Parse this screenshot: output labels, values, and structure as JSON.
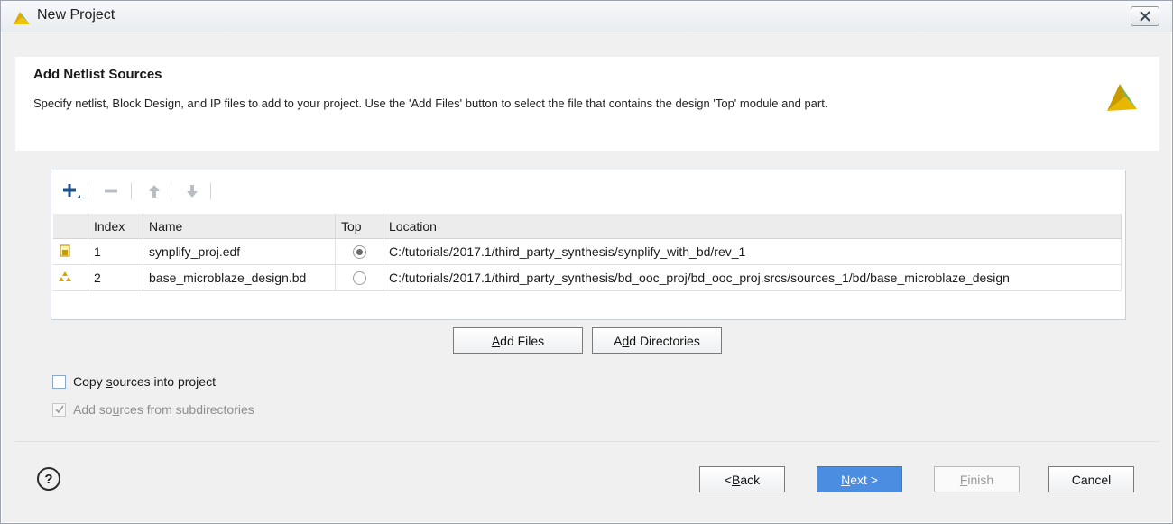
{
  "window": {
    "title": "New Project"
  },
  "header": {
    "heading": "Add Netlist Sources",
    "description": "Specify netlist, Block Design, and IP files to add to your project. Use the 'Add Files' button to select the file that contains the design 'Top' module and part."
  },
  "table": {
    "columns": [
      "Index",
      "Name",
      "Top",
      "Location"
    ],
    "rows": [
      {
        "icon": "netlist-file-icon",
        "index": "1",
        "name": "synplify_proj.edf",
        "top": true,
        "location": "C:/tutorials/2017.1/third_party_synthesis/synplify_with_bd/rev_1"
      },
      {
        "icon": "block-design-icon",
        "index": "2",
        "name": "base_microblaze_design.bd",
        "top": false,
        "location": "C:/tutorials/2017.1/third_party_synthesis/bd_ooc_proj/bd_ooc_proj.srcs/sources_1/bd/base_microblaze_design"
      }
    ]
  },
  "buttons": {
    "add_files": {
      "pre": "",
      "key": "A",
      "post": "dd Files"
    },
    "add_directories": {
      "pre": "A",
      "key": "d",
      "post": "d Directories"
    },
    "back": {
      "pre": "< ",
      "key": "B",
      "post": "ack"
    },
    "next": {
      "pre": "",
      "key": "N",
      "post": "ext >"
    },
    "finish": {
      "pre": "",
      "key": "F",
      "post": "inish"
    },
    "cancel": "Cancel"
  },
  "options": {
    "copy_sources": {
      "pre": "Copy ",
      "key": "s",
      "post": "ources into project",
      "checked": false
    },
    "add_subdirs": {
      "pre": "Add so",
      "key": "u",
      "post": "rces from subdirectories",
      "checked": true,
      "disabled": true
    }
  },
  "help": "?",
  "colors": {
    "accent": "#4b8de0",
    "plus": "#1f4f8c",
    "logo": "#c79a00"
  }
}
